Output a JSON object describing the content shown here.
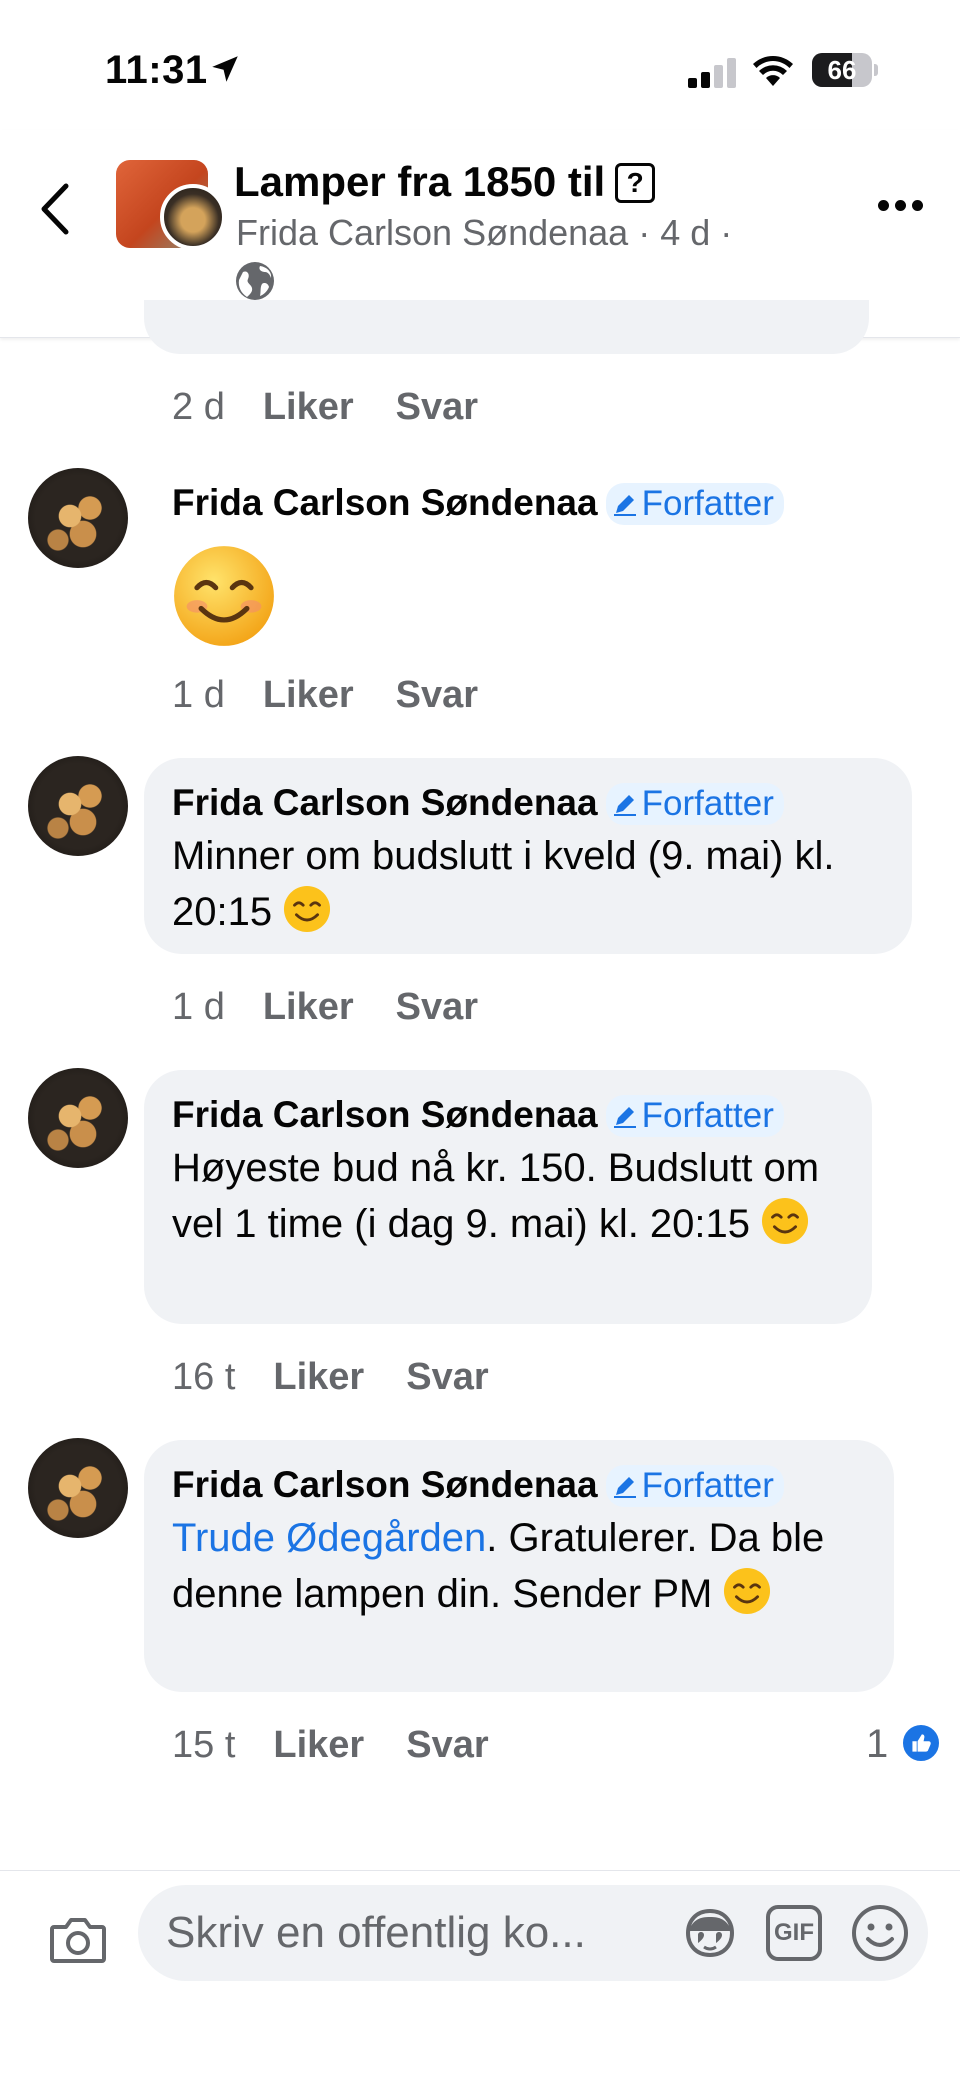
{
  "status_bar": {
    "time": "11:31",
    "battery": "66",
    "battery_level": 0.66
  },
  "header": {
    "title": "Lamper fra 1850 til",
    "subtitle": "Frida Carlson Søndenaa · 4 d ·"
  },
  "comments": [
    {
      "time": "2 d",
      "like_label": "Liker",
      "reply_label": "Svar"
    },
    {
      "author": "Frida Carlson Søndenaa",
      "badge": "Forfatter",
      "emoji_only": "smiling-face",
      "time": "1 d",
      "like_label": "Liker",
      "reply_label": "Svar"
    },
    {
      "author": "Frida Carlson Søndenaa",
      "badge": "Forfatter",
      "text": "Minner om budslutt i kveld (9. mai) kl. 20:15",
      "time": "1 d",
      "like_label": "Liker",
      "reply_label": "Svar"
    },
    {
      "author": "Frida Carlson Søndenaa",
      "badge": "Forfatter",
      "text": "Høyeste bud nå kr. 150. Budslutt om vel 1 time (i dag 9. mai) kl. 20:15",
      "time": "16 t",
      "like_label": "Liker",
      "reply_label": "Svar"
    },
    {
      "author": "Frida Carlson Søndenaa",
      "badge": "Forfatter",
      "mention": "Trude Ødegården",
      "text": ". Gratulerer. Da ble denne lampen din. Sender PM",
      "time": "15 t",
      "like_label": "Liker",
      "reply_label": "Svar",
      "reactions": "1"
    }
  ],
  "composer": {
    "placeholder": "Skriv en offentlig ko...",
    "gif_label": "GIF"
  },
  "colors": {
    "accent": "#1b74e4",
    "bubble": "#f0f2f5",
    "secondary_text": "#65676b"
  }
}
